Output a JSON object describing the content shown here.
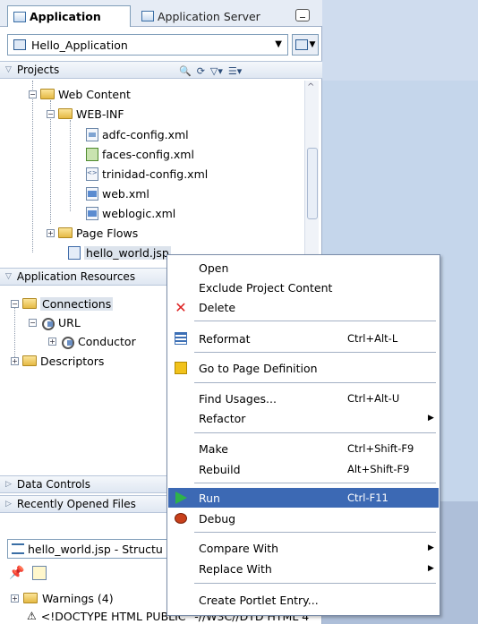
{
  "tabs": {
    "application": "Application",
    "application_server": "Application Server"
  },
  "app_selector": {
    "value": "Hello_Application"
  },
  "projects": {
    "header": "Projects"
  },
  "tree": {
    "web_content": "Web Content",
    "web_inf": "WEB-INF",
    "adfc_config": "adfc-config.xml",
    "faces_config": "faces-config.xml",
    "trinidad_config": "trinidad-config.xml",
    "web_xml": "web.xml",
    "weblogic_xml": "weblogic.xml",
    "page_flows": "Page Flows",
    "hello_world_jsp": "hello_world.jsp"
  },
  "resources": {
    "header": "Application Resources",
    "connections": "Connections",
    "url": "URL",
    "conductor": "Conductor",
    "descriptors": "Descriptors"
  },
  "collapsed_sections": {
    "data_controls": "Data Controls",
    "recently_opened": "Recently Opened Files"
  },
  "structure": {
    "title": "hello_world.jsp - Structu",
    "warnings": "Warnings (4)",
    "doctype": "<!DOCTYPE HTML PUBLIC \"-//W3C//DTD HTML 4"
  },
  "context_menu": {
    "open": "Open",
    "exclude": "Exclude Project Content",
    "delete": "Delete",
    "reformat": "Reformat",
    "reformat_accel": "Ctrl+Alt-L",
    "goto_pagedef": "Go to Page Definition",
    "find_usages": "Find Usages...",
    "find_usages_accel": "Ctrl+Alt-U",
    "refactor": "Refactor",
    "make": "Make",
    "make_accel": "Ctrl+Shift-F9",
    "rebuild": "Rebuild",
    "rebuild_accel": "Alt+Shift-F9",
    "run": "Run",
    "run_accel": "Ctrl-F11",
    "debug": "Debug",
    "compare_with": "Compare With",
    "replace_with": "Replace With",
    "create_portlet": "Create Portlet Entry..."
  },
  "colors": {
    "menu_highlight": "#3c69b4",
    "run_icon": "#2fb34a",
    "delete_icon": "#dd2222"
  }
}
